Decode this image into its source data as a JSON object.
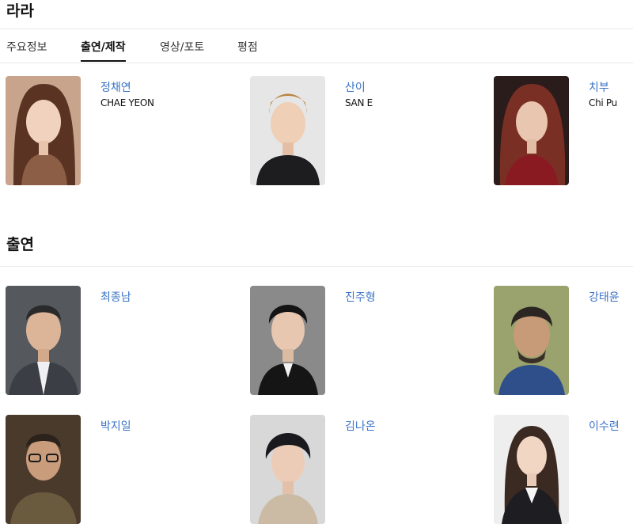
{
  "page": {
    "title": "라라"
  },
  "tabs": [
    {
      "label": "주요정보"
    },
    {
      "label": "출연/제작"
    },
    {
      "label": "영상/포토"
    },
    {
      "label": "평점"
    }
  ],
  "production": [
    {
      "name": "정채연",
      "en_name": "CHAE YEON",
      "photo": "portrait-woman"
    },
    {
      "name": "산이",
      "en_name": "SAN E",
      "photo": "portrait-man"
    },
    {
      "name": "치부",
      "en_name": "Chi Pu",
      "photo": "portrait-woman"
    }
  ],
  "cast_section": {
    "title": "출연"
  },
  "cast": [
    {
      "name": "최종남",
      "photo": "portrait-man"
    },
    {
      "name": "진주형",
      "photo": "portrait-man"
    },
    {
      "name": "강태윤",
      "photo": "portrait-man"
    },
    {
      "name": "박지일",
      "photo": "portrait-man"
    },
    {
      "name": "김나온",
      "photo": "portrait-man"
    },
    {
      "name": "이수련",
      "photo": "portrait-woman"
    }
  ],
  "colors": {
    "link": "#3a73c5",
    "divider": "#e8e8e8"
  }
}
